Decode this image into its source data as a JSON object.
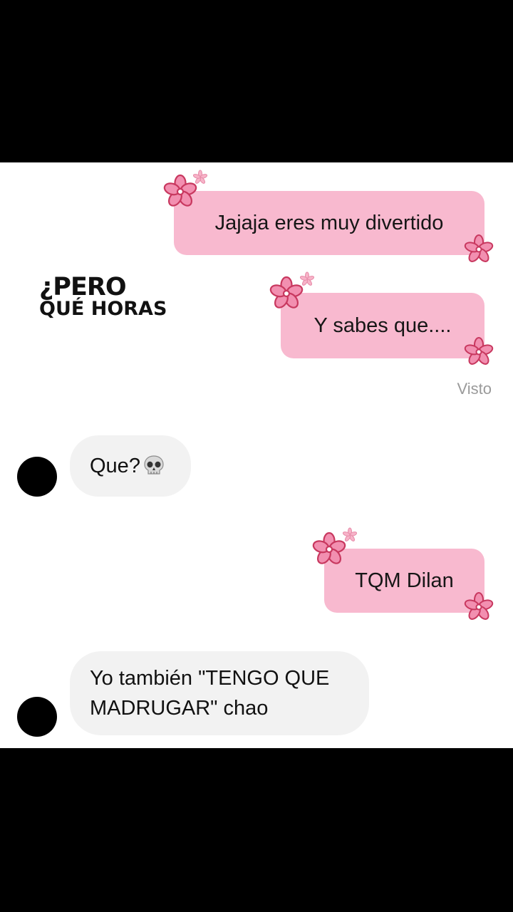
{
  "conversation": {
    "watermark": {
      "line1": "¿PERO",
      "line2": "QUÉ HORAS"
    },
    "messages": [
      {
        "id": "m1",
        "direction": "outgoing",
        "text": "Jajaja eres muy divertido"
      },
      {
        "id": "m2",
        "direction": "outgoing",
        "text": "Y sabes que...."
      },
      {
        "id": "m3",
        "direction": "incoming",
        "text": "Que?",
        "emoji": "skull-emoji"
      },
      {
        "id": "m4",
        "direction": "outgoing",
        "text": "TQM Dilan"
      },
      {
        "id": "m5",
        "direction": "incoming",
        "text_line1": "Yo también \"TENGO QUE",
        "text_line2": "MADRUGAR\" chao"
      }
    ],
    "seen_label": "Visto"
  },
  "colors": {
    "outgoing_bubble": "#f8b9cf",
    "incoming_bubble": "#f2f2f2",
    "flower": "#d0466e",
    "avatar": "#000000",
    "letterbox": "#000000"
  },
  "icons": [
    "flower-sticker-icon",
    "sparkle-icon",
    "skull-emoji",
    "avatar"
  ]
}
